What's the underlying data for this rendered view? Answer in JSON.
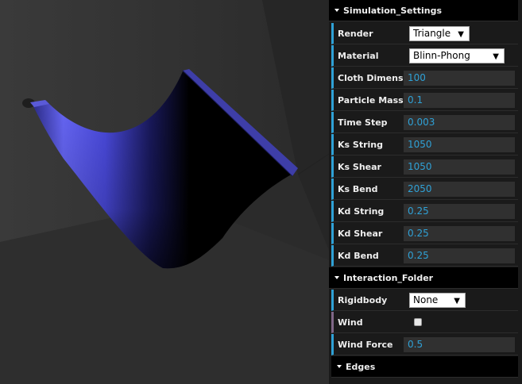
{
  "simulation_settings": {
    "title": "Simulation_Settings",
    "render": {
      "label": "Render",
      "value": "Triangle"
    },
    "material": {
      "label": "Material",
      "value": "Blinn-Phong"
    },
    "params": [
      {
        "label": "Cloth Dimension",
        "value": "100"
      },
      {
        "label": "Particle Mass",
        "value": "0.1"
      },
      {
        "label": "Time Step",
        "value": "0.003"
      },
      {
        "label": "Ks String",
        "value": "1050"
      },
      {
        "label": "Ks Shear",
        "value": "1050"
      },
      {
        "label": "Ks Bend",
        "value": "2050"
      },
      {
        "label": "Kd String",
        "value": "0.25"
      },
      {
        "label": "Kd Shear",
        "value": "0.25"
      },
      {
        "label": "Kd Bend",
        "value": "0.25"
      }
    ]
  },
  "interaction_folder": {
    "title": "Interaction_Folder",
    "rigidbody": {
      "label": "Rigidbody",
      "value": "None"
    },
    "wind": {
      "label": "Wind",
      "checked": false
    },
    "wind_force": {
      "label": "Wind Force",
      "value": "0.5"
    }
  },
  "edges_folder": {
    "title": "Edges"
  },
  "colors": {
    "cloth": "#4a4ae0",
    "panel_bg": "#1a1a1a",
    "number_text": "#2fa1d6",
    "scene_bg": "#2b2b2b"
  }
}
